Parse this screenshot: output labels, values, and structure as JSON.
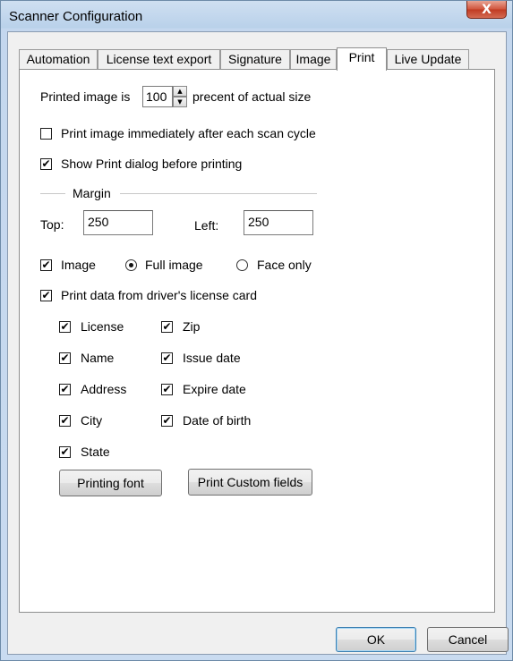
{
  "window": {
    "title": "Scanner Configuration",
    "close_glyph": "X"
  },
  "tabs": [
    {
      "label": "Automation",
      "active": false
    },
    {
      "label": "License text export",
      "active": false
    },
    {
      "label": "Signature",
      "active": false
    },
    {
      "label": "Image",
      "active": false
    },
    {
      "label": "Print",
      "active": true
    },
    {
      "label": "Live Update",
      "active": false
    }
  ],
  "print": {
    "scale": {
      "prefix": "Printed image is",
      "value": "100",
      "suffix": "precent of actual size"
    },
    "print_after_scan": {
      "label": "Print image immediately after each scan cycle",
      "checked": false
    },
    "show_dialog": {
      "label": "Show Print dialog before printing",
      "checked": true
    },
    "margin": {
      "group_label": "Margin",
      "top_label": "Top:",
      "top_value": "250",
      "left_label": "Left:",
      "left_value": "250"
    },
    "image_opt": {
      "label": "Image",
      "checked": true
    },
    "full_image": {
      "label": "Full image",
      "selected": true
    },
    "face_only": {
      "label": "Face only",
      "selected": false
    },
    "print_data": {
      "label": "Print data from driver's license card",
      "checked": true
    },
    "fields_left": [
      {
        "label": "License",
        "checked": true
      },
      {
        "label": "Name",
        "checked": true
      },
      {
        "label": "Address",
        "checked": true
      },
      {
        "label": "City",
        "checked": true
      },
      {
        "label": "State",
        "checked": true
      }
    ],
    "fields_right": [
      {
        "label": "Zip",
        "checked": true
      },
      {
        "label": "Issue date",
        "checked": true
      },
      {
        "label": "Expire date",
        "checked": true
      },
      {
        "label": "Date of birth",
        "checked": true
      }
    ],
    "printing_font_button": "Printing font",
    "custom_fields_button": "Print Custom fields"
  },
  "footer": {
    "ok_label": "OK",
    "cancel_label": "Cancel"
  },
  "glyphs": {
    "check": "✔",
    "spin_up": "▲",
    "spin_down": "▼"
  }
}
